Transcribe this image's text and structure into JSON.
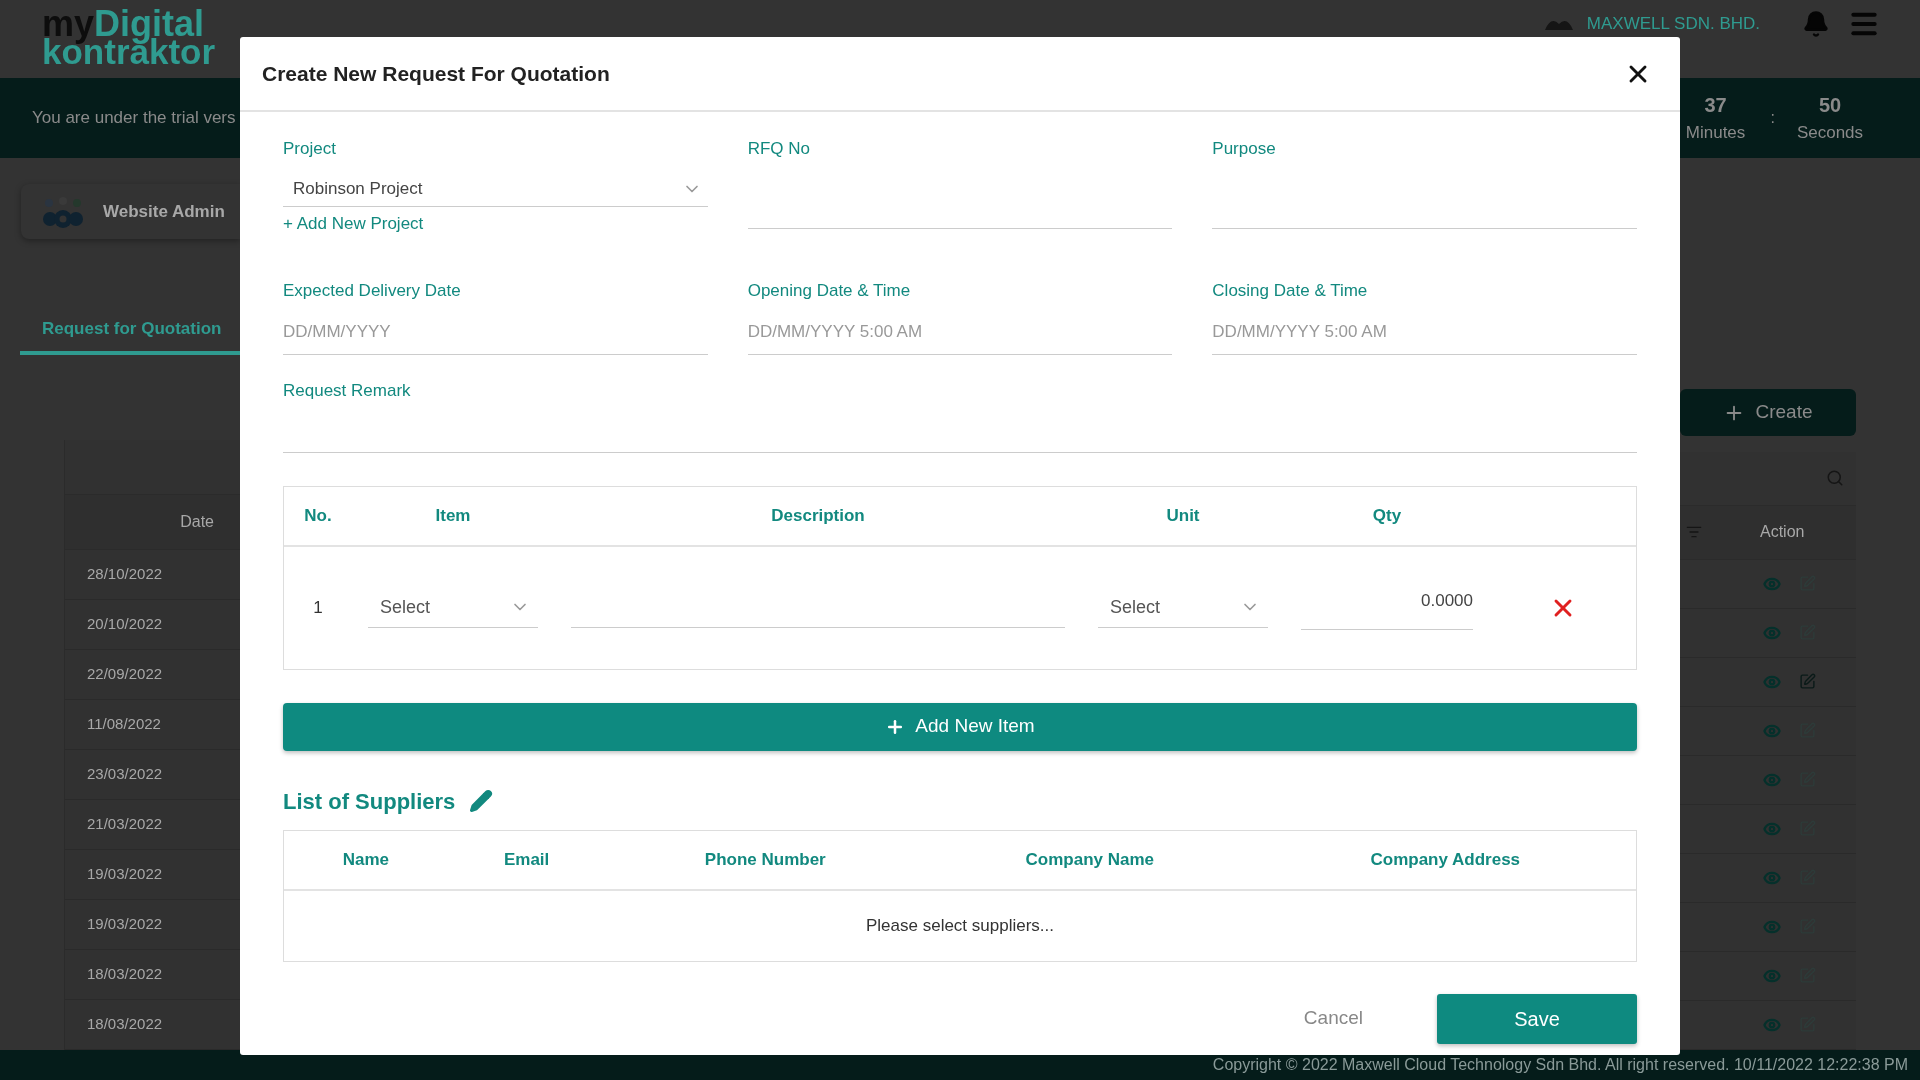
{
  "header": {
    "logo_first": "my",
    "logo_accent": "Digital",
    "logo_second": "kontraktor",
    "company": "MAXWELL SDN. BHD."
  },
  "trial_banner": {
    "message": "You are under the trial vers",
    "separator": ":",
    "timer": [
      {
        "value": "37",
        "unit": "Minutes"
      },
      {
        "value": "50",
        "unit": "Seconds"
      }
    ]
  },
  "role_card": {
    "label": "Website Admin"
  },
  "tabs": [
    {
      "label": "Request for Quotation",
      "selected": true
    }
  ],
  "create_button": "Create",
  "table": {
    "columns": [
      "Date",
      "Action"
    ],
    "rows": [
      {
        "date": "28/10/2022",
        "edit_enabled": false
      },
      {
        "date": "20/10/2022",
        "edit_enabled": false
      },
      {
        "date": "22/09/2022",
        "edit_enabled": true
      },
      {
        "date": "11/08/2022",
        "edit_enabled": false
      },
      {
        "date": "23/03/2022",
        "edit_enabled": false
      },
      {
        "date": "21/03/2022",
        "edit_enabled": false
      },
      {
        "date": "19/03/2022",
        "edit_enabled": false
      },
      {
        "date": "19/03/2022",
        "edit_enabled": false
      },
      {
        "date": "18/03/2022",
        "edit_enabled": false
      },
      {
        "date": "18/03/2022",
        "edit_enabled": false
      }
    ]
  },
  "modal": {
    "title": "Create New Request For Quotation",
    "fields_row_1": [
      {
        "kind": "select",
        "label": "Project",
        "value": "Robinson Project",
        "link": "+ Add New Project"
      },
      {
        "kind": "text",
        "label": "RFQ No"
      },
      {
        "kind": "text",
        "label": "Purpose"
      }
    ],
    "fields_row_2": [
      {
        "kind": "date",
        "label": "Expected Delivery Date",
        "placeholder": "DD/MM/YYYY"
      },
      {
        "kind": "date",
        "label": "Opening Date & Time",
        "placeholder": "DD/MM/YYYY 5:00 AM"
      },
      {
        "kind": "date",
        "label": "Closing Date & Time",
        "placeholder": "DD/MM/YYYY 5:00 AM"
      }
    ],
    "remark": {
      "label": "Request Remark"
    },
    "items": {
      "columns": [
        "No.",
        "Item",
        "Description",
        "Unit",
        "Qty"
      ],
      "rows": [
        {
          "no": "1",
          "item": "Select",
          "unit": "Select",
          "qty": "0.0000"
        }
      ]
    },
    "add_item_button": "Add New Item",
    "suppliers": {
      "title": "List of Suppliers",
      "columns": [
        "Name",
        "Email",
        "Phone Number",
        "Company Name",
        "Company Address"
      ],
      "empty_message": "Please select suppliers..."
    },
    "buttons": {
      "cancel": "Cancel",
      "save": "Save"
    }
  },
  "footer": {
    "copyright": "Copyright © 2022 Maxwell Cloud Technology Sdn Bhd. All right reserved. 10/11/2022 12:22:38 PM"
  }
}
